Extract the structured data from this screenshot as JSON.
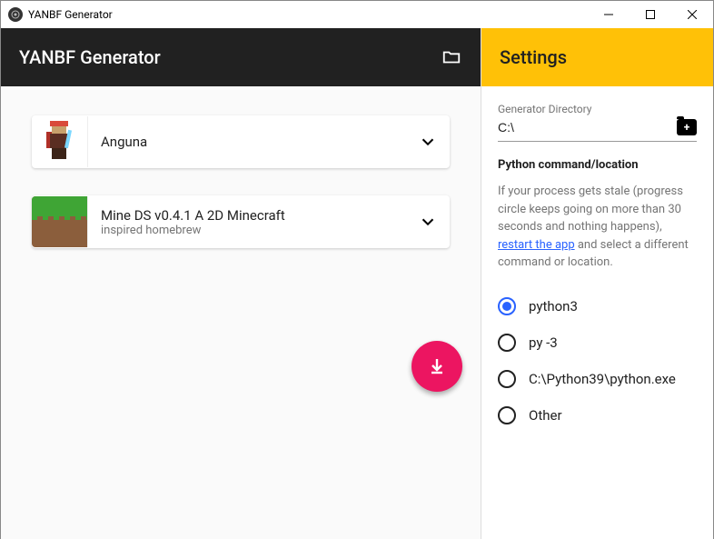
{
  "window": {
    "title": "YANBF Generator"
  },
  "header": {
    "left_title": "YANBF Generator",
    "right_title": "Settings"
  },
  "items": [
    {
      "title": "Anguna",
      "subtitle": ""
    },
    {
      "title": "Mine DS v0.4.1 A 2D Minecraft",
      "subtitle": "inspired homebrew"
    }
  ],
  "settings": {
    "dir_label": "Generator Directory",
    "dir_value": "C:\\",
    "python_section": "Python command/location",
    "help_pre": "If your process gets stale (progress circle keeps going on more than 30 seconds and nothing happens), ",
    "help_link": "restart the app",
    "help_post": " and select a different command or location.",
    "options": [
      {
        "label": "python3",
        "selected": true
      },
      {
        "label": "py -3",
        "selected": false
      },
      {
        "label": "C:\\Python39\\python.exe",
        "selected": false
      },
      {
        "label": "Other",
        "selected": false
      }
    ]
  }
}
